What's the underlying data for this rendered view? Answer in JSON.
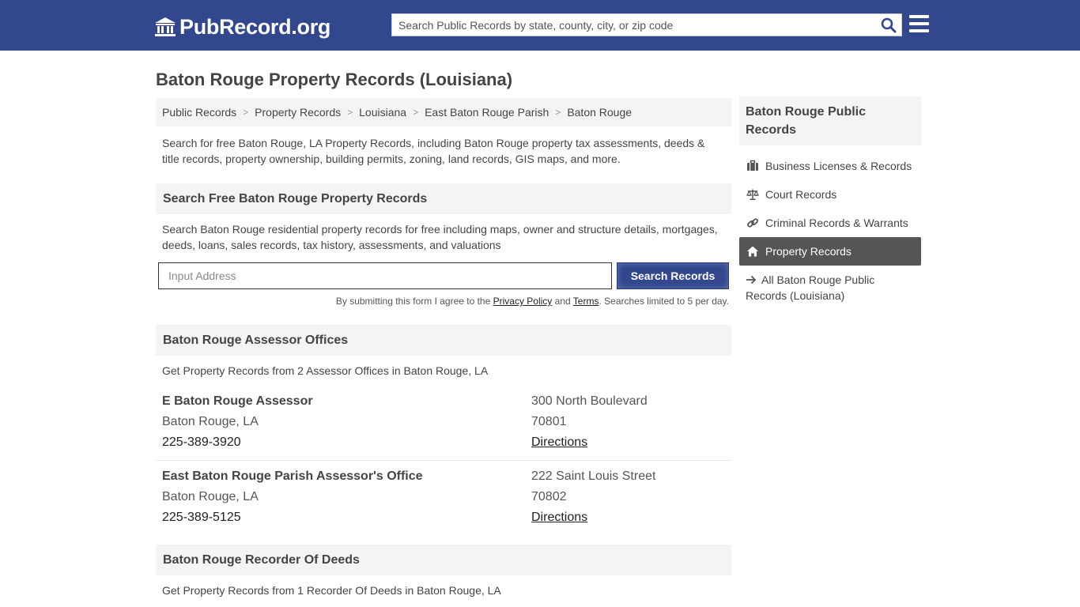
{
  "header": {
    "logo_text": "PubRecord.org",
    "search_placeholder": "Search Public Records by state, county, city, or zip code",
    "icons": {
      "logo": "courthouse-icon",
      "search": "search-icon",
      "menu": "hamburger-menu-icon"
    },
    "colors": {
      "bar": "#33478f"
    }
  },
  "page": {
    "title": "Baton Rouge Property Records (Louisiana)",
    "breadcrumb": [
      "Public Records",
      "Property Records",
      "Louisiana",
      "East Baton Rouge Parish",
      "Baton Rouge"
    ],
    "breadcrumb_sep": ">",
    "intro": "Search for free Baton Rouge, LA Property Records, including Baton Rouge property tax assessments, deeds & title records, property ownership, building permits, zoning, land records, GIS maps, and more."
  },
  "search_section": {
    "heading": "Search Free Baton Rouge Property Records",
    "description": "Search Baton Rouge residential property records for free including maps, owner and structure details, mortgages, deeds, loans, sales records, tax history, assessments, and valuations",
    "input_placeholder": "Input Address",
    "button_label": "Search Records",
    "disclaimer_prefix": "By submitting this form I agree to the ",
    "privacy_label": "Privacy Policy",
    "and_text": " and ",
    "terms_label": "Terms",
    "disclaimer_suffix": ". Searches limited to 5 per day."
  },
  "assessors": {
    "heading": "Baton Rouge Assessor Offices",
    "description": "Get Property Records from 2 Assessor Offices in Baton Rouge, LA",
    "offices": [
      {
        "name": "E Baton Rouge Assessor",
        "city": "Baton Rouge, LA",
        "phone": "225-389-3920",
        "street": "300 North Boulevard",
        "zip": "70801",
        "directions": "Directions"
      },
      {
        "name": "East Baton Rouge Parish Assessor's Office",
        "city": "Baton Rouge, LA",
        "phone": "225-389-5125",
        "street": "222 Saint Louis Street",
        "zip": "70802",
        "directions": "Directions"
      }
    ]
  },
  "recorders": {
    "heading": "Baton Rouge Recorder Of Deeds",
    "description": "Get Property Records from 1 Recorder Of Deeds in Baton Rouge, LA"
  },
  "sidebar": {
    "heading": "Baton Rouge Public Records",
    "items": [
      {
        "label": "Business Licenses & Records",
        "icon": "briefcase-icon"
      },
      {
        "label": "Court Records",
        "icon": "scales-icon"
      },
      {
        "label": "Criminal Records & Warrants",
        "icon": "link-icon"
      },
      {
        "label": "Property Records",
        "icon": "home-icon",
        "active": true
      }
    ],
    "all_link": "All Baton Rouge Public Records (Louisiana)",
    "all_icon": "arrow-right-icon"
  }
}
